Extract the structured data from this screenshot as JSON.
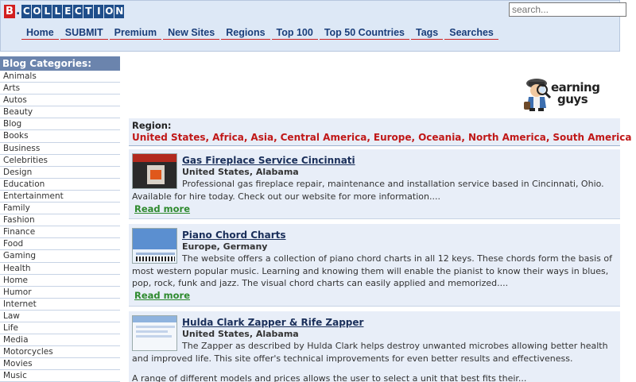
{
  "site": {
    "logo_letter": "B",
    "logo_word": [
      "C",
      "O",
      "L",
      "L",
      "E",
      "C",
      "T",
      "I",
      "O",
      "N"
    ],
    "search_placeholder": "search..."
  },
  "nav": [
    {
      "label": "Home"
    },
    {
      "label": "SUBMIT"
    },
    {
      "label": "Premium"
    },
    {
      "label": "New Sites"
    },
    {
      "label": "Regions"
    },
    {
      "label": "Top 100"
    },
    {
      "label": "Top 50 Countries"
    },
    {
      "label": "Tags"
    },
    {
      "label": "Searches"
    }
  ],
  "sidebar": {
    "title": "Blog Categories:",
    "items": [
      "Animals",
      "Arts",
      "Autos",
      "Beauty",
      "Blog",
      "Books",
      "Business",
      "Celebrities",
      "Design",
      "Education",
      "Entertainment",
      "Family",
      "Fashion",
      "Finance",
      "Food",
      "Gaming",
      "Health",
      "Home",
      "Humor",
      "Internet",
      "Law",
      "Life",
      "Media",
      "Motorcycles",
      "Movies",
      "Music"
    ]
  },
  "promo": {
    "line1": "earning",
    "line2": "guys"
  },
  "region": {
    "label": "Region:",
    "links": [
      "United States",
      "Africa",
      "Asia",
      "Central America",
      "Europe",
      "Oceania",
      "North America",
      "South America"
    ]
  },
  "listings": [
    {
      "title": "Gas Fireplace Service Cincinnati",
      "location": "United States, Alabama",
      "description": "Professional gas fireplace repair, maintenance and installation service based in Cincinnati, Ohio. Available for hire today. Check out our website for more information....",
      "read_more": "Read more"
    },
    {
      "title": "Piano Chord Charts",
      "location": "Europe, Germany",
      "description": "The website offers a collection of piano chord charts in all 12 keys. These chords form the basis of most western popular music. Learning and knowing them will enable the pianist to know their ways in blues, pop, rock, funk and jazz. The visual chord charts can easily applied and memorized....",
      "read_more": "Read more"
    },
    {
      "title": "Hulda Clark Zapper & Rife Zapper",
      "location": "United States, Alabama",
      "description": "The Zapper as described by Hulda Clark helps destroy unwanted microbes allowing better health and improved life. This site offer's technical improvements for even better results and effectiveness.",
      "read_more": ""
    }
  ],
  "tail_text": "A range of different models and prices allows the user to select a unit that best fits their..."
}
